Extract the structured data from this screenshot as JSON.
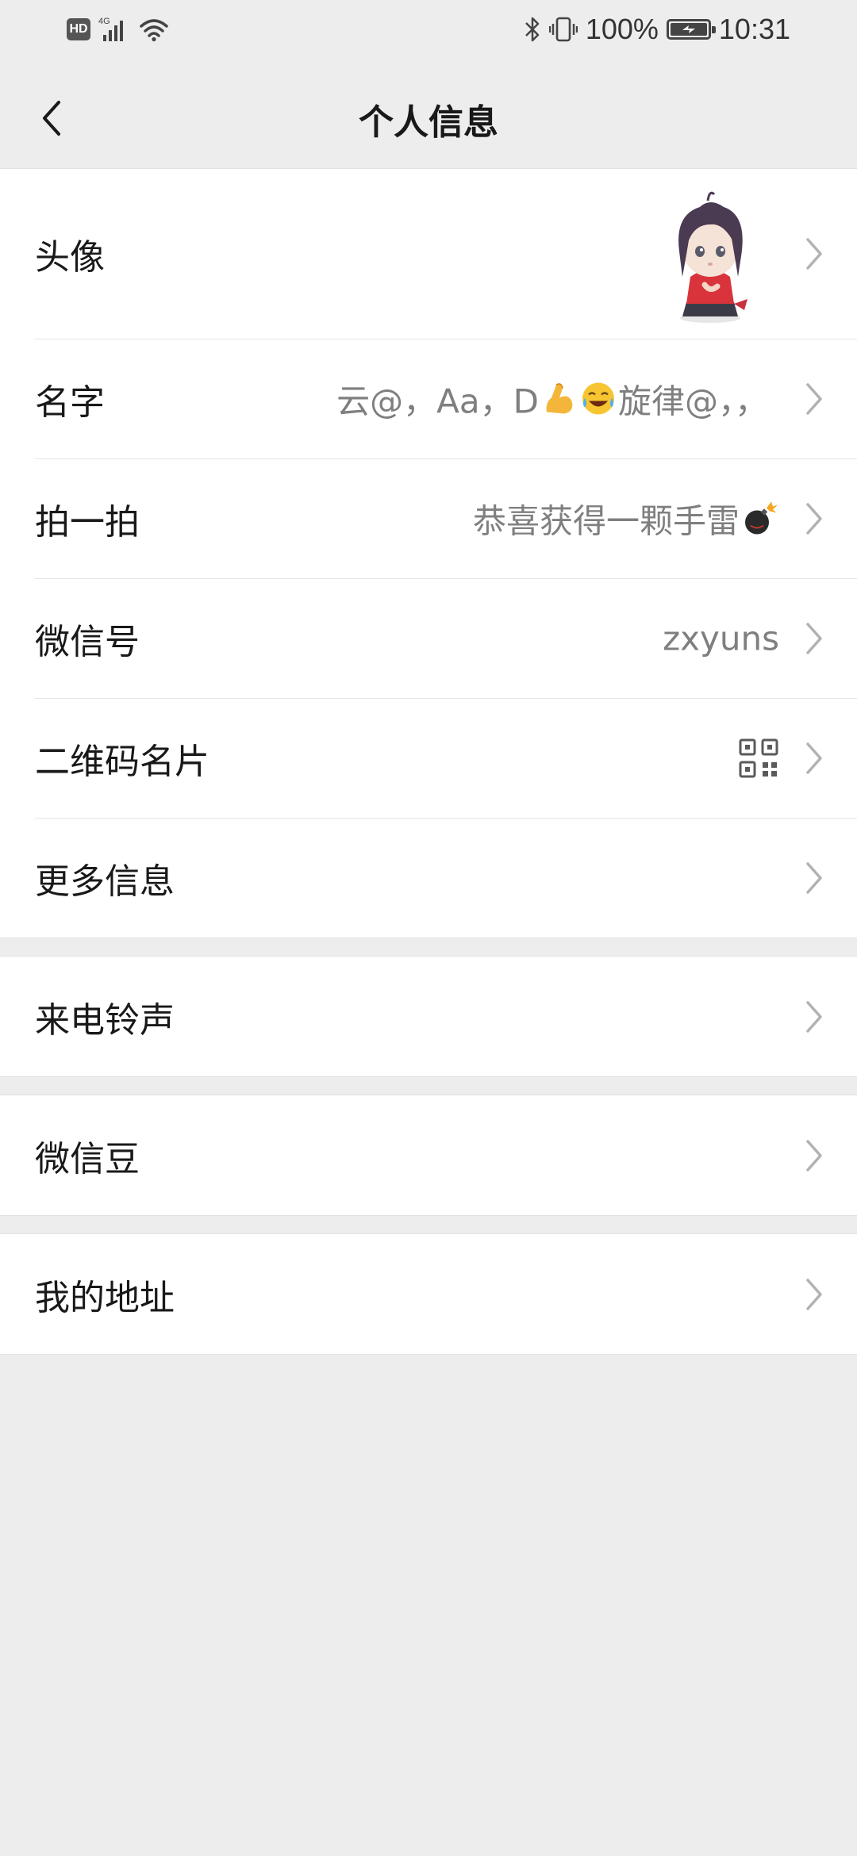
{
  "status_bar": {
    "hd_badge": "HD",
    "network": "4G",
    "battery_percent": "100%",
    "time": "10:31",
    "battery_level": 1.0
  },
  "header": {
    "title": "个人信息"
  },
  "profile_rows": [
    {
      "label": "头像"
    },
    {
      "label": "名字",
      "value_prefix": "云@，Aa，D",
      "value_suffix": "旋律@，，",
      "emojis": [
        "flexed-biceps-emoji",
        "tears-of-joy-emoji"
      ]
    },
    {
      "label": "拍一拍",
      "value": "恭喜获得一颗手雷",
      "emoji": "bomb-emoji"
    },
    {
      "label": "微信号",
      "value": "zxyuns"
    },
    {
      "label": "二维码名片",
      "icon": "qr-code-icon"
    },
    {
      "label": "更多信息"
    }
  ],
  "ringtone": {
    "label": "来电铃声"
  },
  "wechat_beans": {
    "label": "微信豆"
  },
  "address": {
    "label": "我的地址"
  },
  "colors": {
    "background": "#ededed",
    "card": "#ffffff",
    "text_primary": "#191919",
    "text_secondary": "#7f7f7f",
    "chevron": "#b2b2b2"
  }
}
